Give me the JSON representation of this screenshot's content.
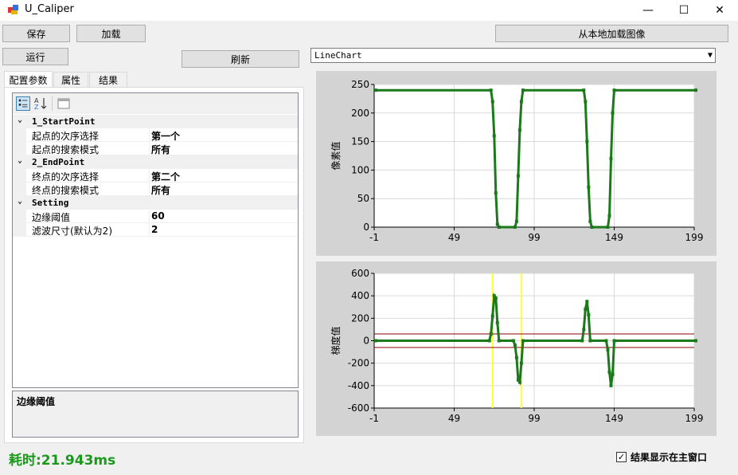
{
  "window": {
    "title": "U_Caliper",
    "min": "—",
    "max": "☐",
    "close": "✕"
  },
  "buttons": {
    "save": "保存",
    "load": "加载",
    "load_image": "从本地加载图像",
    "run": "运行",
    "refresh": "刷新"
  },
  "combo": {
    "selected": "LineChart"
  },
  "tabs": [
    "配置参数",
    "属性",
    "结果"
  ],
  "property_grid": {
    "categories": [
      {
        "name": "1_StartPoint",
        "props": [
          {
            "name": "起点的次序选择",
            "value": "第一个"
          },
          {
            "name": "起点的搜索模式",
            "value": "所有"
          }
        ]
      },
      {
        "name": "2_EndPoint",
        "props": [
          {
            "name": "终点的次序选择",
            "value": "第二个"
          },
          {
            "name": "终点的搜索模式",
            "value": "所有"
          }
        ]
      },
      {
        "name": "Setting",
        "props": [
          {
            "name": "边缘阈值",
            "value": "60"
          },
          {
            "name": "滤波尺寸(默认为2)",
            "value": "2"
          }
        ]
      }
    ],
    "description_title": "边缘阈值"
  },
  "status": {
    "elapsed": "耗时:21.943ms",
    "checkbox_label": "结果显示在主窗口",
    "checkbox_checked": true
  },
  "colors": {
    "series": "#1a7a1a",
    "threshold": "#8b0000",
    "edge_marker": "#ffff33",
    "elapsed_text": "#1a9a1a"
  },
  "chart_data": [
    {
      "type": "line",
      "ylabel": "像素值",
      "xlabel": "",
      "xlim": [
        -1,
        199
      ],
      "ylim": [
        0,
        250
      ],
      "x_ticks": [
        -1,
        49,
        99,
        149,
        199
      ],
      "y_ticks": [
        0,
        50,
        100,
        150,
        200,
        250
      ],
      "grid": true,
      "series": [
        {
          "points": [
            [
              0,
              240
            ],
            [
              72,
              240
            ],
            [
              73,
              220
            ],
            [
              74,
              160
            ],
            [
              75,
              60
            ],
            [
              76,
              5
            ],
            [
              77,
              0
            ],
            [
              87,
              0
            ],
            [
              88,
              10
            ],
            [
              89,
              90
            ],
            [
              90,
              170
            ],
            [
              91,
              220
            ],
            [
              92,
              240
            ],
            [
              130,
              240
            ],
            [
              131,
              220
            ],
            [
              132,
              150
            ],
            [
              133,
              70
            ],
            [
              134,
              10
            ],
            [
              135,
              0
            ],
            [
              145,
              0
            ],
            [
              146,
              20
            ],
            [
              147,
              120
            ],
            [
              148,
              200
            ],
            [
              149,
              240
            ],
            [
              200,
              240
            ]
          ]
        }
      ]
    },
    {
      "type": "line",
      "ylabel": "梯度值",
      "xlabel": "",
      "xlim": [
        -1,
        199
      ],
      "ylim": [
        -600,
        600
      ],
      "x_ticks": [
        -1,
        49,
        99,
        149,
        199
      ],
      "y_ticks": [
        -600,
        -400,
        -200,
        0,
        200,
        400,
        600
      ],
      "grid": true,
      "thresholds": [
        60,
        -60
      ],
      "edge_markers_x": [
        73,
        91
      ],
      "series": [
        {
          "points": [
            [
              0,
              0
            ],
            [
              71,
              0
            ],
            [
              72,
              60
            ],
            [
              73,
              220
            ],
            [
              74,
              400
            ],
            [
              75,
              380
            ],
            [
              76,
              160
            ],
            [
              77,
              0
            ],
            [
              86,
              0
            ],
            [
              87,
              -40
            ],
            [
              88,
              -150
            ],
            [
              89,
              -350
            ],
            [
              90,
              -370
            ],
            [
              91,
              -200
            ],
            [
              92,
              0
            ],
            [
              129,
              0
            ],
            [
              130,
              100
            ],
            [
              131,
              280
            ],
            [
              132,
              350
            ],
            [
              133,
              230
            ],
            [
              134,
              0
            ],
            [
              144,
              0
            ],
            [
              145,
              -80
            ],
            [
              146,
              -280
            ],
            [
              147,
              -400
            ],
            [
              148,
              -300
            ],
            [
              149,
              0
            ],
            [
              200,
              0
            ]
          ]
        }
      ]
    }
  ]
}
